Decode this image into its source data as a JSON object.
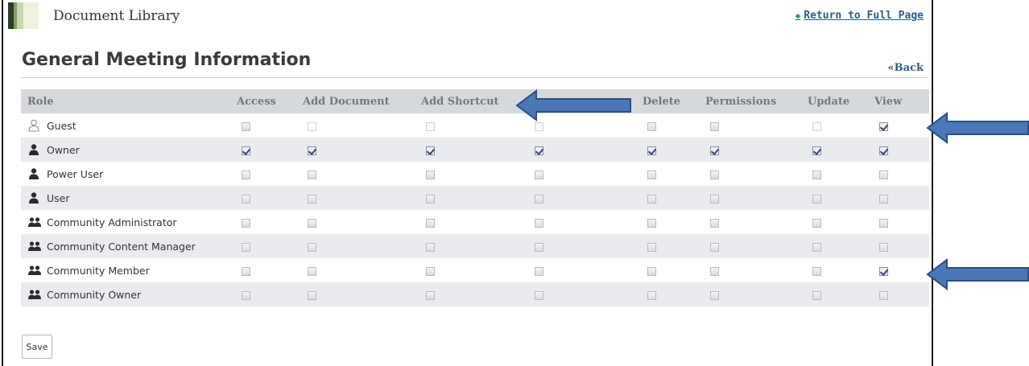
{
  "portlet": {
    "title": "Document Library",
    "return_link": "Return to Full Page"
  },
  "page": {
    "title": "General Meeting Information",
    "back_link": "«Back"
  },
  "table": {
    "columns": [
      "Role",
      "Access",
      "Add Document",
      "Add Shortcut",
      "",
      "Delete",
      "Permissions",
      "Update",
      "View"
    ],
    "rows": [
      {
        "role": "Guest",
        "icon": "guest-user-icon",
        "perms": [
          "off",
          "disabled",
          "disabled",
          "disabled",
          "off",
          "off",
          "disabled",
          "on"
        ]
      },
      {
        "role": "Owner",
        "icon": "user-icon",
        "perms": [
          "on",
          "on",
          "on",
          "on",
          "on",
          "on",
          "on",
          "on"
        ]
      },
      {
        "role": "Power User",
        "icon": "user-icon",
        "perms": [
          "off",
          "off",
          "off",
          "off",
          "off",
          "off",
          "off",
          "off"
        ]
      },
      {
        "role": "User",
        "icon": "user-icon",
        "perms": [
          "off",
          "off",
          "off",
          "off",
          "off",
          "off",
          "off",
          "off"
        ]
      },
      {
        "role": "Community Administrator",
        "icon": "group-icon",
        "perms": [
          "off",
          "off",
          "off",
          "off",
          "off",
          "off",
          "off",
          "off"
        ]
      },
      {
        "role": "Community Content Manager",
        "icon": "group-icon",
        "perms": [
          "off",
          "off",
          "off",
          "off",
          "off",
          "off",
          "off",
          "off"
        ]
      },
      {
        "role": "Community Member",
        "icon": "group-icon",
        "perms": [
          "off",
          "off",
          "off",
          "off",
          "off",
          "off",
          "off",
          "on"
        ]
      },
      {
        "role": "Community Owner",
        "icon": "group-icon",
        "perms": [
          "off",
          "off",
          "off",
          "off",
          "off",
          "off",
          "off",
          "off"
        ]
      }
    ]
  },
  "save_label": "Save",
  "annotation_arrows": [
    {
      "name": "arrow-add-shortcut",
      "direction": "left"
    },
    {
      "name": "arrow-guest-view",
      "direction": "left"
    },
    {
      "name": "arrow-community-member-view",
      "direction": "left"
    }
  ],
  "colors": {
    "link": "#2a5d8a",
    "header_bg": "#d6d9dc",
    "row_alt_bg": "#e9ebee",
    "arrow_fill": "#4a78b6",
    "arrow_stroke": "#2c4f80"
  }
}
